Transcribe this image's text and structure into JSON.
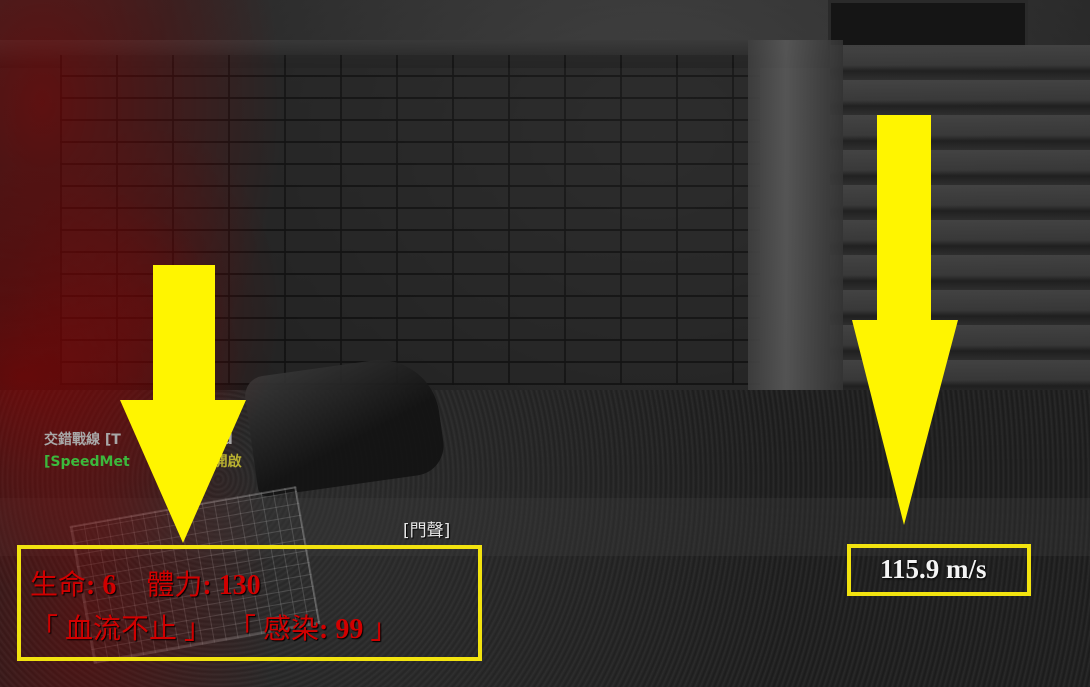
{
  "chat": {
    "line1_prefix": "交錯戰線",
    "line1_rest": "[T",
    "line1_end": "eed",
    "line2_prefix": "[SpeedMet",
    "line2_end": "開啟"
  },
  "caption": "[門聲]",
  "status": {
    "health_label": "生命",
    "health_value": ": 6",
    "stamina_label": "體力",
    "stamina_value": ": 130",
    "bleeding": "「 血流不止 」",
    "infection_open": "「 感染",
    "infection_value": ": 99",
    "infection_close": " 」"
  },
  "speedometer": {
    "value": "115.9 m/s"
  },
  "colors": {
    "highlight": "#f2e30f",
    "status_text": "#d10000",
    "chat_green": "#3cb83c"
  }
}
